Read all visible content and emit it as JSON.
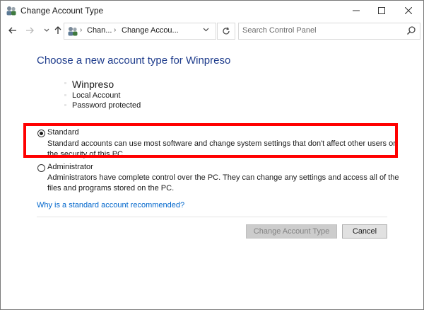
{
  "window": {
    "title": "Change Account Type",
    "app_icon": "users-control-panel-icon",
    "controls": {
      "minimize": "minimize-icon",
      "maximize": "maximize-icon",
      "close": "close-icon"
    }
  },
  "nav": {
    "back_icon": "arrow-left-icon",
    "forward_icon": "arrow-right-icon",
    "recent_icon": "chevron-down-icon",
    "up_icon": "arrow-up-icon",
    "breadcrumbs": [
      "Chan...",
      "Change Accou..."
    ],
    "search_placeholder": "Search Control Panel"
  },
  "main": {
    "heading": "Choose a new account type for Winpreso",
    "user": {
      "name": "Winpreso",
      "details": [
        "Local Account",
        "Password protected"
      ]
    },
    "options": [
      {
        "label": "Standard",
        "selected": true,
        "description": "Standard accounts can use most software and change system settings that don't affect other users or the security of this PC."
      },
      {
        "label": "Administrator",
        "selected": false,
        "description": "Administrators have complete control over the PC. They can change any settings and access all of the files and programs stored on the PC."
      }
    ],
    "help_link": "Why is a standard account recommended?",
    "buttons": {
      "change": "Change Account Type",
      "cancel": "Cancel"
    },
    "highlight_color": "#ff0000",
    "heading_color": "#1e3c8c",
    "link_color": "#0066cc"
  }
}
